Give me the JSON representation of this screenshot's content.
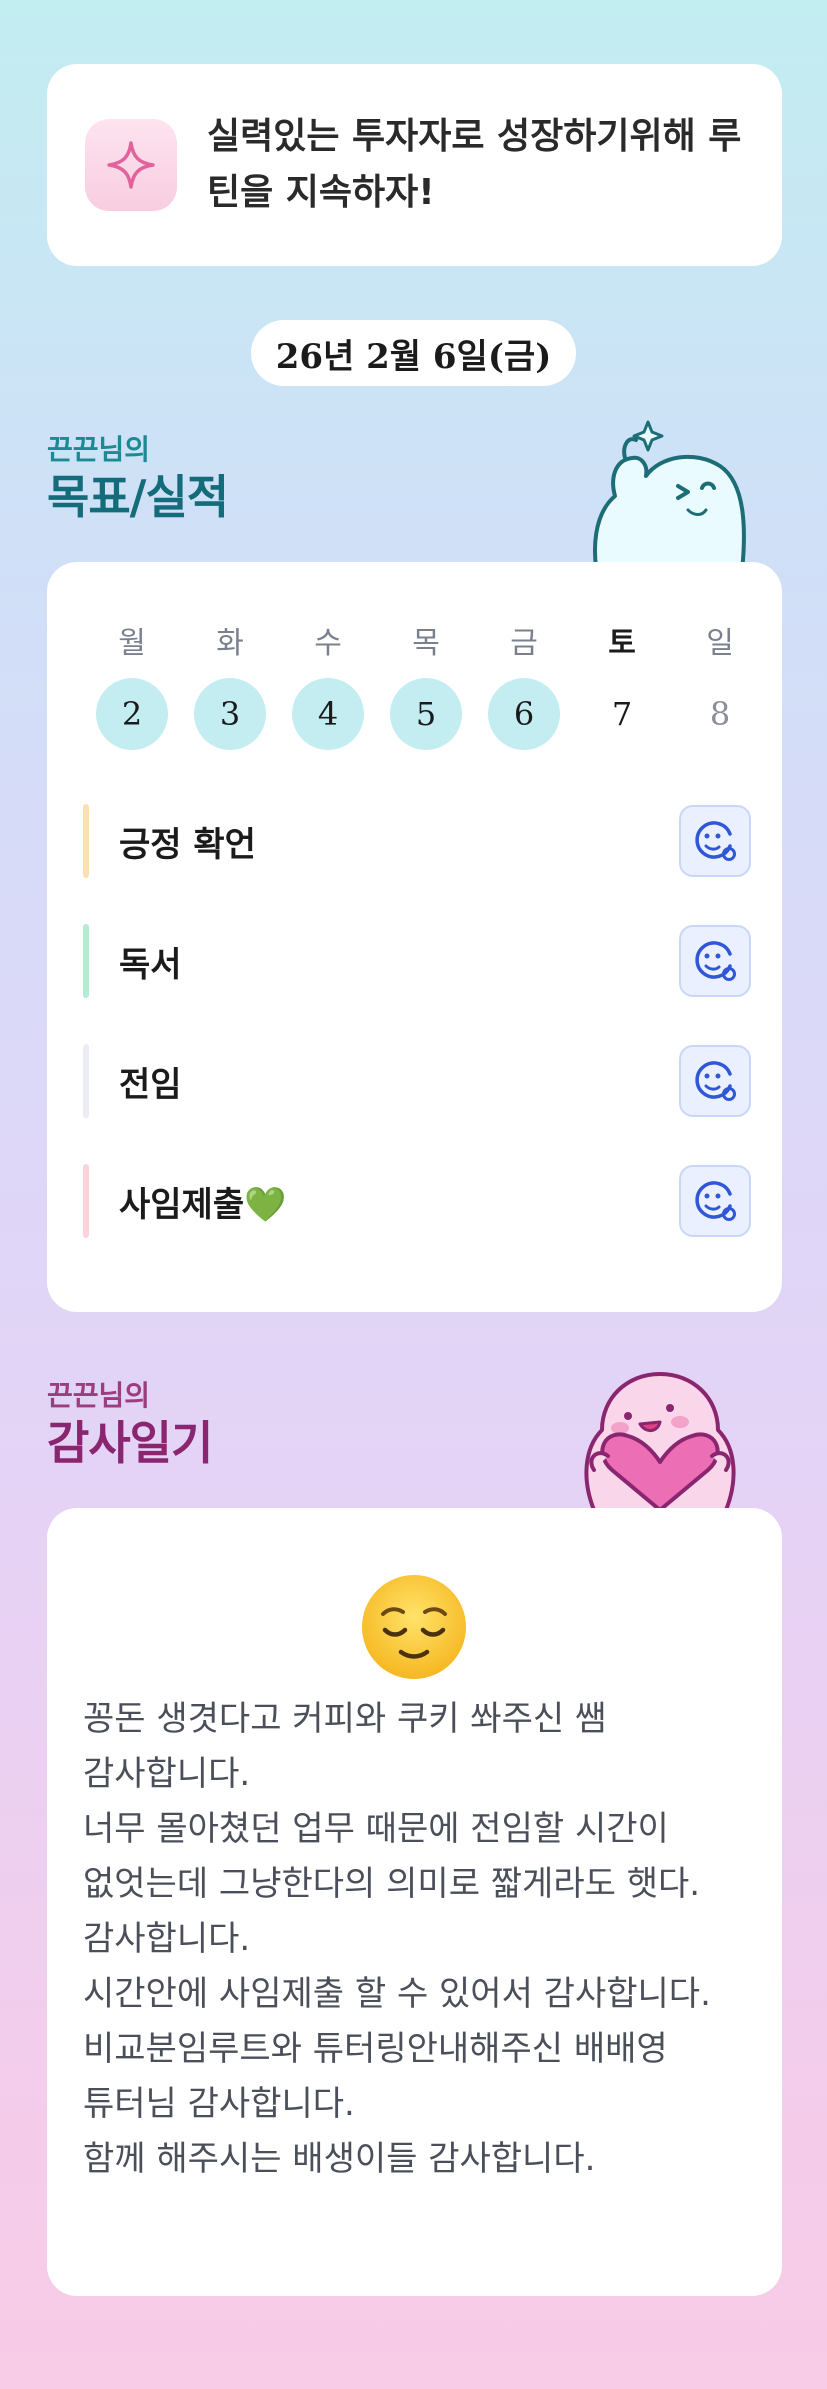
{
  "motto": {
    "icon": "sparkle-icon",
    "text": "실력있는 투자자로 성장하기위해 루틴을 지속하자!"
  },
  "date": "26년 2월 6일(금)",
  "goals_section": {
    "subtitle": "끈끈님의",
    "title": "목표/실적"
  },
  "week": {
    "days": [
      "월",
      "화",
      "수",
      "목",
      "금",
      "토",
      "일"
    ],
    "dates": [
      "2",
      "3",
      "4",
      "5",
      "6",
      "7",
      "8"
    ],
    "done": [
      true,
      true,
      true,
      true,
      true,
      false,
      false
    ]
  },
  "goals": [
    {
      "label": "긍정 확언",
      "color": "#fde0b2",
      "icon": "smile-plus-icon"
    },
    {
      "label": "독서",
      "color": "#b4ecd2",
      "icon": "smile-plus-icon"
    },
    {
      "label": "전임",
      "color": "#ececf5",
      "icon": "smile-plus-icon"
    },
    {
      "label": "사임제출💚",
      "color": "#fcd3d9",
      "icon": "smile-plus-icon"
    }
  ],
  "diary_section": {
    "subtitle": "끈끈님의",
    "title": "감사일기"
  },
  "diary": {
    "emoji": "relieved-face",
    "text": "꽁돈 생겻다고 커피와 쿠키 쏴주신 쌤 감사합니다.\n너무 몰아쳤던 업무 때문에 전임할 시간이 없엇는데 그냥한다의 의미로 짧게라도 햇다. 감사합니다.\n시간안에 사임제출 할 수 있어서 감사합니다.\n비교분임루트와 튜터링안내해주신 배배영 튜터님 감사합니다.\n함께 해주시는 배생이들 감사합니다."
  },
  "colors": {
    "accent_teal": "#146b79",
    "accent_magenta": "#8a2570",
    "done_circle": "#c3edf1"
  }
}
